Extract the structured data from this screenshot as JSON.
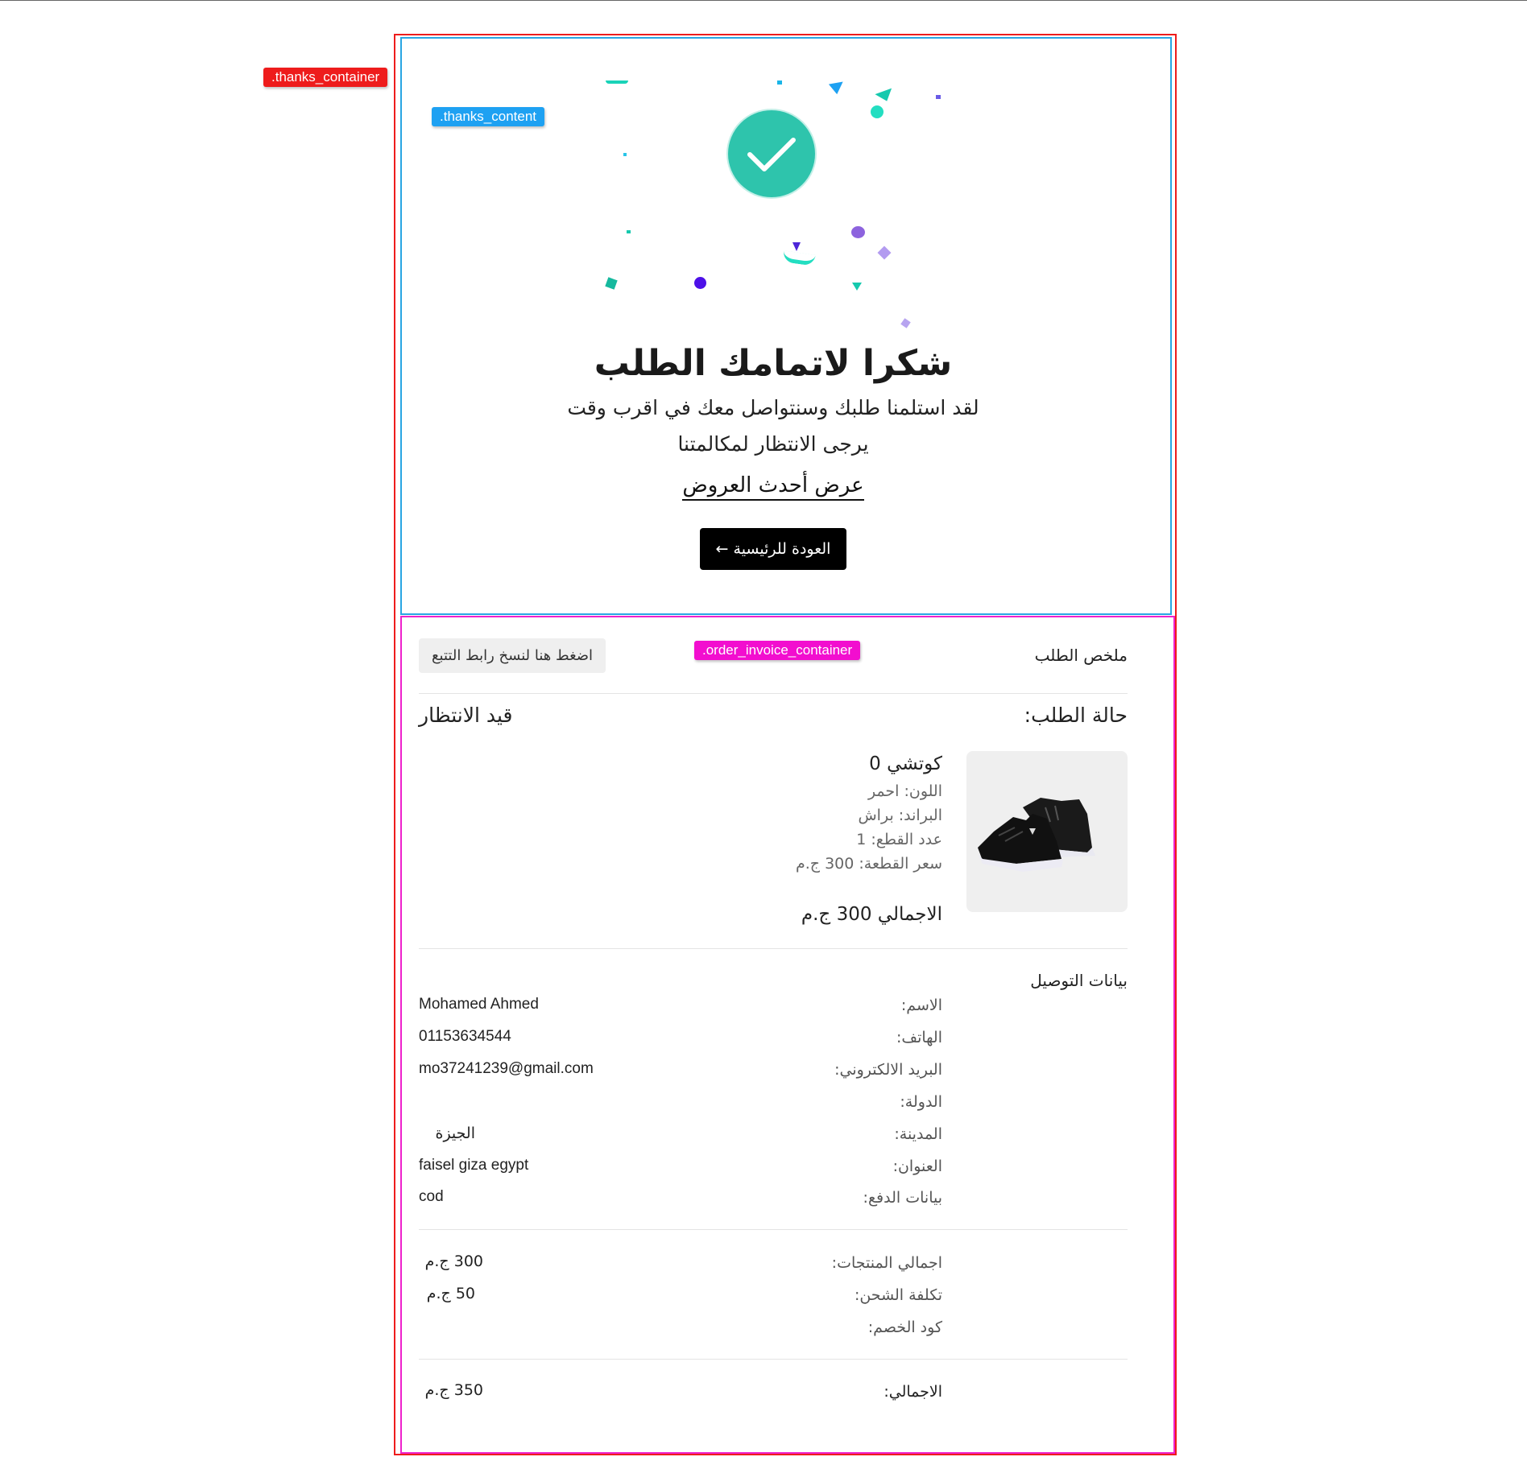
{
  "debug_tags": {
    "thanks_container": ".thanks_container",
    "thanks_content": ".thanks_content",
    "order_invoice_container": ".order_invoice_container"
  },
  "colors": {
    "success": "#2ec4ac",
    "primary_button": "#000000",
    "thanks_container_outline": "#ee1c1c",
    "thanks_content_outline": "#29a5e3",
    "invoice_outline": "#ee22cc"
  },
  "thanks": {
    "icon": "check-icon",
    "title": "شكرا لاتمامك الطلب",
    "message_line1": "لقد استلمنا طلبك وسنتواصل معك في اقرب وقت",
    "message_line2": "يرجى الانتظار لمكالمتنا",
    "offers_link": "عرض أحدث العروض",
    "home_button": "العودة للرئيسية ←"
  },
  "invoice": {
    "summary_title": "ملخص الطلب",
    "copy_tracking_button": "اضغط هنا لنسخ رابط التتبع",
    "status_label": "حالة الطلب:",
    "status_value": "قيد الانتظار",
    "product": {
      "image": "black-sneakers-image",
      "name": "كوتشي 0",
      "color": "اللون: احمر",
      "brand": "البراند: براش",
      "quantity": "عدد القطع: 1",
      "unit_price": "سعر القطعة: 300 ج.م",
      "total": "الاجمالي 300 ج.م"
    },
    "delivery": {
      "title": "بيانات التوصيل",
      "rows": [
        {
          "label": "الاسم:",
          "value": "Mohamed Ahmed"
        },
        {
          "label": "الهاتف:",
          "value": "01153634544"
        },
        {
          "label": "البريد الالكتروني:",
          "value": "mo37241239@gmail.com"
        },
        {
          "label": "الدولة:",
          "value": ""
        },
        {
          "label": "المدينة:",
          "value": "الجيزة"
        },
        {
          "label": "العنوان:",
          "value": "faisel giza egypt"
        },
        {
          "label": "بيانات الدفع:",
          "value": "cod"
        }
      ]
    },
    "totals": {
      "products_label": "اجمالي المنتجات:",
      "products_value": "300 ج.م",
      "shipping_label": "تكلفة الشحن:",
      "shipping_value": "50 ج.م",
      "discount_label": "كود الخصم:",
      "discount_value": "",
      "grand_label": "الاجمالي:",
      "grand_value": "350 ج.م"
    }
  }
}
